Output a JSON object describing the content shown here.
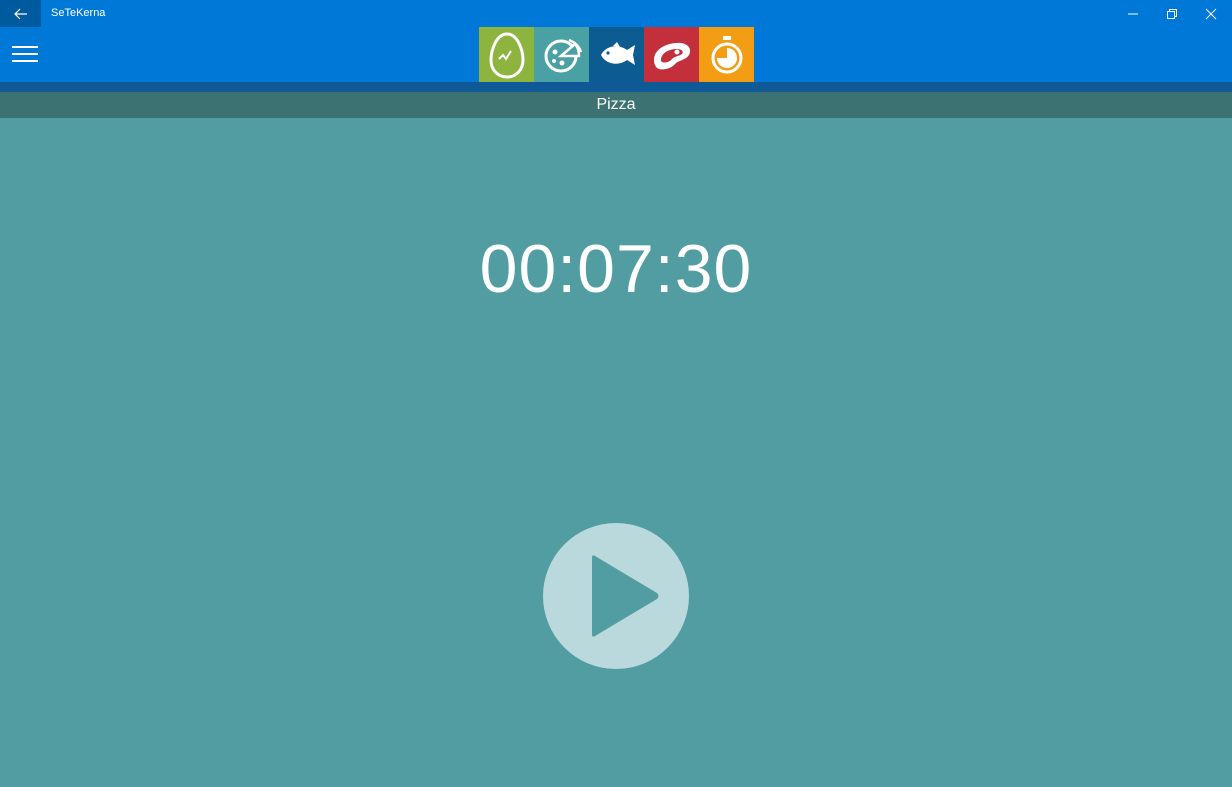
{
  "window": {
    "title": "SeTeKerna"
  },
  "header": {
    "tiles": [
      {
        "name": "egg",
        "color": "#8db43e"
      },
      {
        "name": "pizza",
        "color": "#4aa1a3"
      },
      {
        "name": "fish",
        "color": "#0c5b91"
      },
      {
        "name": "steak",
        "color": "#c42f3c"
      },
      {
        "name": "stopwatch",
        "color": "#f39d14"
      }
    ]
  },
  "subheader": {
    "label": "Pizza"
  },
  "timer": {
    "display": "00:07:30"
  },
  "icons": {
    "back": "back-arrow-icon",
    "minimize": "minimize-icon",
    "restore": "restore-icon",
    "close": "close-icon",
    "menu": "hamburger-icon",
    "play": "play-icon"
  }
}
